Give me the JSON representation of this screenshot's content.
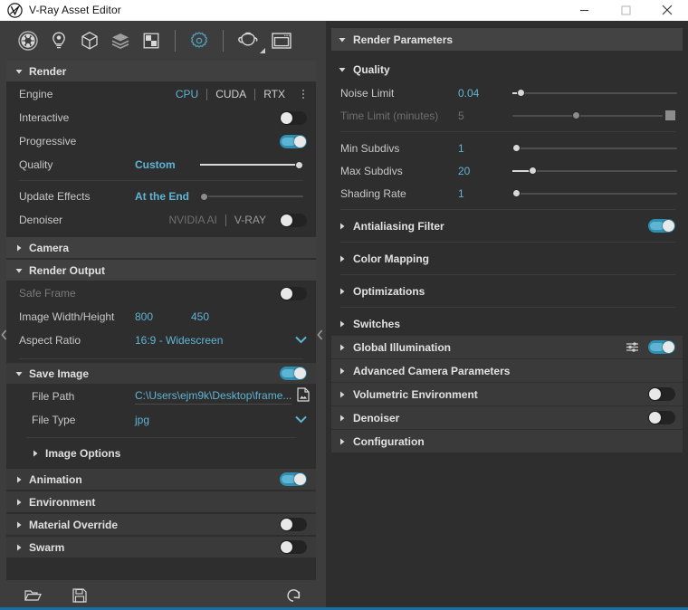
{
  "window": {
    "title": "V-Ray Asset Editor",
    "logo_icon": "vray-logo-icon",
    "minimize_label": "Minimize",
    "maximize_label": "Maximize",
    "close_label": "Close"
  },
  "toolbar": {
    "items": [
      {
        "name": "materials-icon",
        "tooltip": "Materials"
      },
      {
        "name": "lights-icon",
        "tooltip": "Lights"
      },
      {
        "name": "geometry-icon",
        "tooltip": "Geometry"
      },
      {
        "name": "render-elements-icon",
        "tooltip": "Render Elements"
      },
      {
        "name": "textures-icon",
        "tooltip": "Textures"
      },
      {
        "name": "settings-gear-icon",
        "tooltip": "Settings"
      },
      {
        "name": "teapot-render-icon",
        "tooltip": "Render"
      },
      {
        "name": "render-frame-window-icon",
        "tooltip": "Render Frame Window"
      }
    ]
  },
  "left_panel": {
    "render_section": {
      "title": "Render",
      "expanded": true,
      "engine": {
        "label": "Engine",
        "options": [
          "CPU",
          "CUDA",
          "RTX"
        ],
        "selected": "CPU",
        "overflow_icon": "kebab-menu-icon"
      },
      "interactive": {
        "label": "Interactive",
        "enabled": false
      },
      "progressive": {
        "label": "Progressive",
        "enabled": true
      },
      "quality": {
        "label": "Quality",
        "value": "Custom",
        "slider_percent": 100
      },
      "update_effects": {
        "label": "Update Effects",
        "value": "At the End",
        "slider_percent": 0
      },
      "denoiser": {
        "label": "Denoiser",
        "options": [
          "NVIDIA AI",
          "V-RAY"
        ],
        "selected": "V-RAY",
        "enabled": false
      }
    },
    "camera_section": {
      "title": "Camera",
      "expanded": false
    },
    "render_output_section": {
      "title": "Render Output",
      "expanded": true,
      "safe_frame": {
        "label": "Safe Frame",
        "enabled": false,
        "disabled": true
      },
      "image_size": {
        "label": "Image Width/Height",
        "width": "800",
        "height": "450"
      },
      "aspect_ratio": {
        "label": "Aspect Ratio",
        "value": "16:9 - Widescreen"
      }
    },
    "save_image_section": {
      "title": "Save Image",
      "expanded": true,
      "enabled": true,
      "file_path": {
        "label": "File Path",
        "value": "C:\\Users\\ejm9k\\Desktop\\frame...",
        "browse_icon": "file-browse-icon"
      },
      "file_type": {
        "label": "File Type",
        "value": "jpg"
      },
      "image_options": {
        "title": "Image Options",
        "expanded": false
      }
    },
    "animation_section": {
      "title": "Animation",
      "expanded": false,
      "enabled": true
    },
    "environment_section": {
      "title": "Environment",
      "expanded": false
    },
    "material_override_section": {
      "title": "Material Override",
      "expanded": false,
      "enabled": false
    },
    "swarm_section": {
      "title": "Swarm",
      "expanded": false,
      "enabled": false
    },
    "footer": {
      "open_icon": "folder-open-icon",
      "save_icon": "floppy-save-icon",
      "reset_icon": "revert-reset-icon"
    },
    "collapse_left_icon": "chevron-left-icon",
    "collapse_right_icon": "chevron-left-icon"
  },
  "right_panel": {
    "header": {
      "title": "Render Parameters",
      "expanded": true
    },
    "quality": {
      "title": "Quality",
      "expanded": true,
      "rows": [
        {
          "label": "Noise Limit",
          "value": "0.04",
          "slider_percent": 5,
          "disabled": false
        },
        {
          "label": "Time Limit (minutes)",
          "value": "5",
          "slider_percent": 42,
          "disabled": true
        },
        {
          "label": "Min Subdivs",
          "value": "1",
          "slider_percent": 1,
          "disabled": false
        },
        {
          "label": "Max Subdivs",
          "value": "20",
          "slider_percent": 12,
          "disabled": false
        },
        {
          "label": "Shading Rate",
          "value": "1",
          "slider_percent": 1,
          "disabled": false
        }
      ]
    },
    "sections": [
      {
        "title": "Antialiasing Filter",
        "expanded": false,
        "toggle": true,
        "enabled": true
      },
      {
        "title": "Color Mapping",
        "expanded": false,
        "toggle": false
      },
      {
        "title": "Optimizations",
        "expanded": false,
        "toggle": false
      },
      {
        "title": "Switches",
        "expanded": false,
        "toggle": false
      },
      {
        "title": "Global Illumination",
        "expanded": false,
        "toggle": true,
        "enabled": true,
        "extra_icon": "gi-settings-sliders-icon"
      },
      {
        "title": "Advanced Camera Parameters",
        "expanded": false,
        "toggle": false
      },
      {
        "title": "Volumetric Environment",
        "expanded": false,
        "toggle": true,
        "enabled": false
      },
      {
        "title": "Denoiser",
        "expanded": false,
        "toggle": true,
        "enabled": false
      },
      {
        "title": "Configuration",
        "expanded": false,
        "toggle": false
      }
    ]
  },
  "colors": {
    "accent_blue": "#5fb4d4",
    "toggle_on": "#2f8fb0",
    "panel_bg": "#2e2e2e",
    "chrome_bg": "#3d3d3d",
    "section_bg": "#3a3a3a",
    "status_bar": "#1b6ea5"
  }
}
